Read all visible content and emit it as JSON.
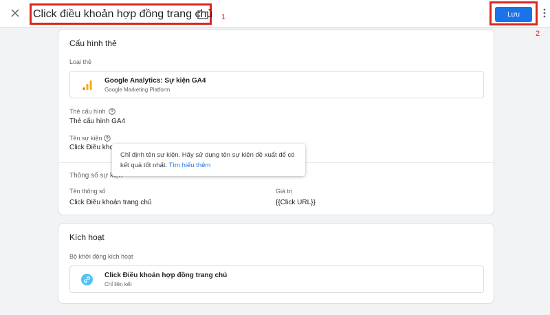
{
  "header": {
    "close_icon": "close-icon",
    "title": "Click điều khoản hợp đồng trang chủ",
    "folder_icon": "folder-icon",
    "annotation_1": "1",
    "save_label": "Lưu",
    "annotation_2": "2",
    "more_icon": "more-vert-icon"
  },
  "config": {
    "title": "Cấu hình thẻ",
    "tag_type_label": "Loại thẻ",
    "tag_type_name": "Google Analytics: Sự kiện GA4",
    "tag_type_vendor": "Google Marketing Platform",
    "config_tag_label": "Thẻ cấu hình",
    "config_tag_value": "Thẻ cấu hình GA4",
    "event_name_label": "Tên sự kiện",
    "event_name_value": "Click Điều kho",
    "params_title": "Thông số sự kiện",
    "param_name_header": "Tên thông số",
    "param_value_header": "Giá trị",
    "param_name": "Click Điều khoản trang chủ",
    "param_value": "{{Click URL}}"
  },
  "tooltip": {
    "text": "Chỉ định tên sự kiện. Hãy sử dụng tên sự kiện đề xuất để có kết quả tốt nhất.",
    "link": "Tìm hiểu thêm"
  },
  "trigger": {
    "title": "Kích hoạt",
    "label": "Bộ khởi động kích hoạt",
    "name": "Click Điều khoản hợp đồng trang chủ",
    "type": "Chỉ liên kết",
    "icon": "link-icon"
  },
  "colors": {
    "accent": "#1a73e8",
    "highlight": "#d9251d",
    "ga_orange": "#f9ab00",
    "ga_dark": "#e37400",
    "link_badge": "#4fc3f7"
  }
}
